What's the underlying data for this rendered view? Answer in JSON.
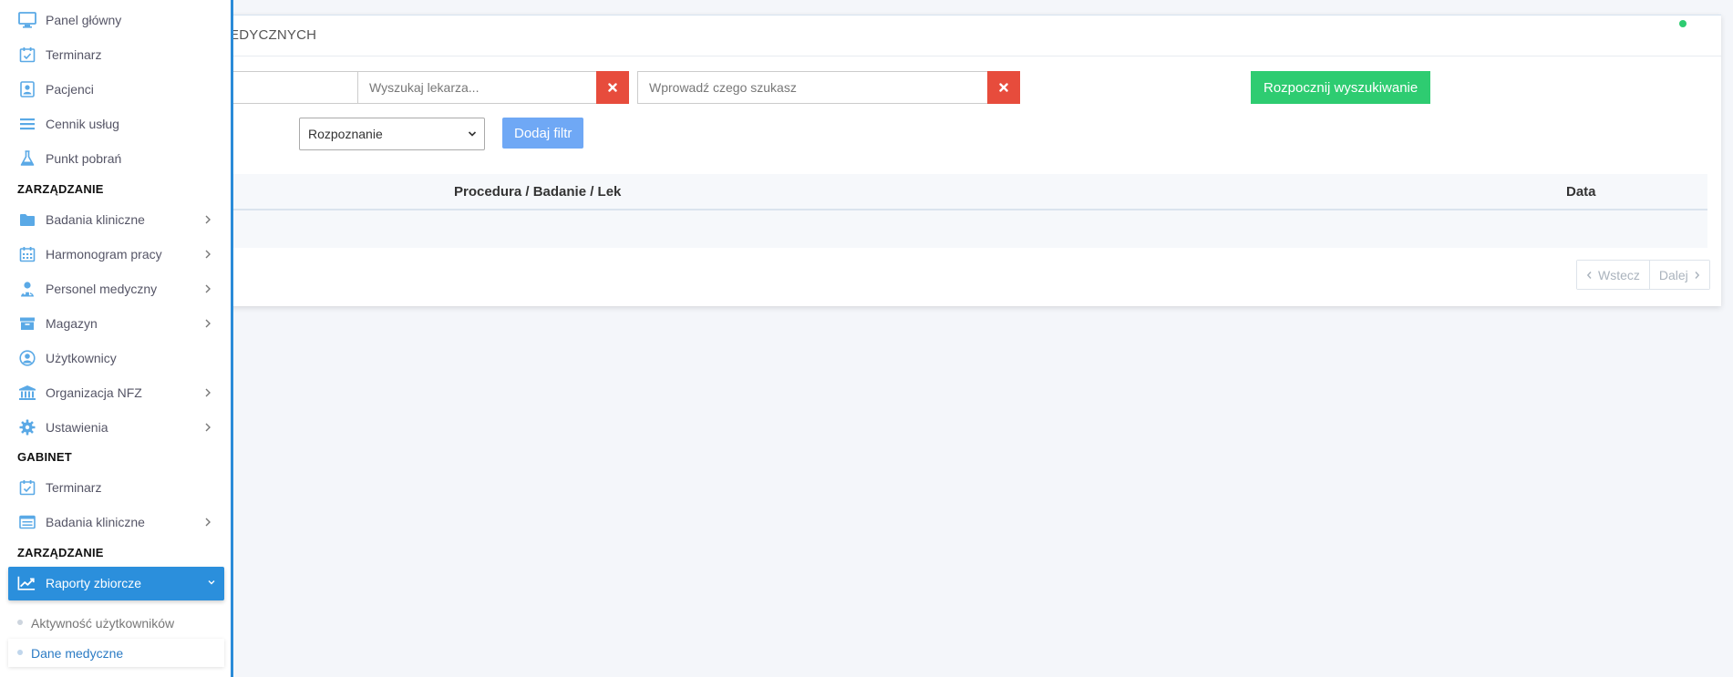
{
  "card": {
    "title_visible": "EDYCZNYCH"
  },
  "filters": {
    "first_input_value": "",
    "doctor_placeholder": "Wyszukaj lekarza...",
    "query_placeholder": "Wprowadź czego szukasz",
    "start_button": "Rozpocznij wyszukiwanie",
    "filter_select_value": "Rozpoznanie",
    "add_filter_button": "Dodaj filtr"
  },
  "table": {
    "columns": [
      "Procedura / Badanie / Lek",
      "Data"
    ],
    "rows": []
  },
  "pager": {
    "prev": "Wstecz",
    "next": "Dalej"
  },
  "colors": {
    "accent": "#2b8fdc",
    "danger": "#e74c3c",
    "success": "#2ecc71",
    "add_filter": "#6fa8f5",
    "icon": "#5aa9e6"
  },
  "sidebar": {
    "items_top": [
      {
        "label": "Panel główny",
        "icon": "monitor-icon"
      },
      {
        "label": "Terminarz",
        "icon": "calendar-check-icon"
      },
      {
        "label": "Pacjenci",
        "icon": "patient-card-icon"
      },
      {
        "label": "Cennik usług",
        "icon": "list-icon"
      },
      {
        "label": "Punkt pobrań",
        "icon": "flask-icon"
      }
    ],
    "section_management": "ZARZĄDZANIE",
    "items_management": [
      {
        "label": "Badania kliniczne",
        "icon": "folder-icon",
        "expandable": true
      },
      {
        "label": "Harmonogram pracy",
        "icon": "calendar-grid-icon",
        "expandable": true
      },
      {
        "label": "Personel medyczny",
        "icon": "doctor-icon",
        "expandable": true
      },
      {
        "label": "Magazyn",
        "icon": "archive-icon",
        "expandable": true
      },
      {
        "label": "Użytkownicy",
        "icon": "user-circle-icon",
        "expandable": false
      },
      {
        "label": "Organizacja NFZ",
        "icon": "institution-icon",
        "expandable": true
      },
      {
        "label": "Ustawienia",
        "icon": "gear-icon",
        "expandable": true
      }
    ],
    "section_office": "GABINET",
    "items_office": [
      {
        "label": "Terminarz",
        "icon": "calendar-check-icon",
        "expandable": false
      },
      {
        "label": "Badania kliniczne",
        "icon": "list-alt-icon",
        "expandable": true
      }
    ],
    "section_management_2": "ZARZĄDZANIE",
    "active_item": {
      "label": "Raporty zbiorcze",
      "icon": "line-chart-icon"
    },
    "sub_items": [
      {
        "label": "Aktywność użytkowników"
      },
      {
        "label": "Dane medyczne"
      }
    ]
  }
}
